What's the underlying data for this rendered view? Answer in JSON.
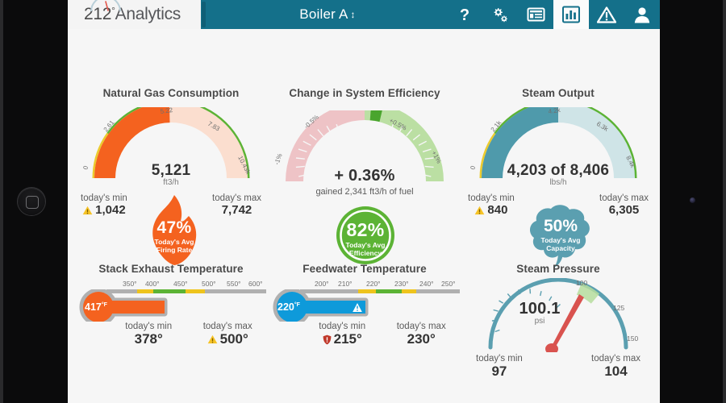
{
  "header": {
    "logo_text": "212",
    "logo_degree": "°",
    "logo_name": "Analytics",
    "title": "Boiler A",
    "title_caret": "↕",
    "icons": [
      {
        "name": "help-icon",
        "label": "?"
      },
      {
        "name": "settings-gears-icon",
        "label": "Settings"
      },
      {
        "name": "reports-list-icon",
        "label": "Reports"
      },
      {
        "name": "dashboard-chart-icon",
        "label": "Dashboard",
        "active": true
      },
      {
        "name": "alerts-warning-icon",
        "label": "Alerts"
      },
      {
        "name": "user-account-icon",
        "label": "Account"
      }
    ]
  },
  "colors": {
    "header_teal": "#14708a",
    "orange": "#f4621f",
    "green": "#5cb335",
    "teal": "#4f9aab",
    "blue": "#0e9ada",
    "yellow": "#f2c014",
    "red": "#d94b4b"
  },
  "panels": {
    "natural_gas": {
      "title": "Natural Gas Consumption",
      "value": "5,121",
      "unit": "ft3/h",
      "ticks": [
        "0",
        "2.61",
        "5.22",
        "7.83",
        "10.43k"
      ],
      "min_label": "today's min",
      "min_value": "1,042",
      "min_warn": true,
      "max_label": "today's max",
      "max_value": "7,742",
      "max_warn": false,
      "badge_pct": "47%",
      "badge_line1": "Today's Avg",
      "badge_line2": "Firing Rate"
    },
    "system_efficiency": {
      "title": "Change in System Efficiency",
      "value": "+ 0.36%",
      "subnote": "gained 2,341 ft3/h of fuel",
      "ticks": [
        "-1%",
        "-0.5%",
        "+0.5%",
        "+1%"
      ],
      "badge_pct": "82%",
      "badge_line1": "Today's Avg",
      "badge_line2": "Efficiency"
    },
    "steam_output": {
      "title": "Steam Output",
      "value": "4,203 of 8,406",
      "unit": "lbs/h",
      "ticks": [
        "0",
        "2.1k",
        "4.2k",
        "6.3k",
        "8.4k"
      ],
      "min_label": "today's min",
      "min_value": "840",
      "min_warn": true,
      "max_label": "today's max",
      "max_value": "6,305",
      "max_warn": false,
      "badge_pct": "50%",
      "badge_line1": "Today's Avg",
      "badge_line2": "Capacity"
    },
    "stack_exhaust": {
      "title": "Stack Exhaust Temperature",
      "value": "417",
      "value_deg": "°F",
      "ticks": [
        "350°",
        "400°",
        "450°",
        "500°",
        "550°",
        "600°"
      ],
      "min_label": "today's min",
      "min_value": "378°",
      "min_warn": false,
      "max_label": "today's max",
      "max_value": "500°",
      "max_warn": true
    },
    "feedwater": {
      "title": "Feedwater Temperature",
      "value": "220",
      "value_deg": "°F",
      "ticks": [
        "200°",
        "210°",
        "220°",
        "230°",
        "240°",
        "250°"
      ],
      "min_label": "today's min",
      "min_value": "215°",
      "min_shield": true,
      "max_label": "today's max",
      "max_value": "230°"
    },
    "steam_pressure": {
      "title": "Steam Pressure",
      "value": "100.1",
      "unit": "psi",
      "ticks": [
        "100",
        "125",
        "150"
      ],
      "min_label": "today's min",
      "min_value": "97",
      "max_label": "today's max",
      "max_value": "104"
    }
  },
  "chart_data": [
    {
      "type": "gauge",
      "title": "Natural Gas Consumption",
      "value": 5121,
      "unit": "ft3/h",
      "range": [
        0,
        10430
      ],
      "tick_values": [
        0,
        2610,
        5220,
        7830,
        10430
      ],
      "tick_labels": [
        "0",
        "2.61",
        "5.22",
        "7.83",
        "10.43k"
      ],
      "today_min": 1042,
      "today_max": 7742,
      "avg_firing_rate_pct": 47
    },
    {
      "type": "gauge",
      "title": "Change in System Efficiency",
      "value": 0.36,
      "unit": "%",
      "range": [
        -1,
        1
      ],
      "tick_values": [
        -1,
        -0.5,
        0.5,
        1
      ],
      "tick_labels": [
        "-1%",
        "-0.5%",
        "+0.5%",
        "+1%"
      ],
      "annotation": "gained 2,341 ft3/h of fuel",
      "avg_efficiency_pct": 82
    },
    {
      "type": "gauge",
      "title": "Steam Output",
      "value": 4203,
      "max_capacity": 8406,
      "unit": "lbs/h",
      "range": [
        0,
        8400
      ],
      "tick_values": [
        0,
        2100,
        4200,
        6300,
        8400
      ],
      "tick_labels": [
        "0",
        "2.1k",
        "4.2k",
        "6.3k",
        "8.4k"
      ],
      "today_min": 840,
      "today_max": 6305,
      "avg_capacity_pct": 50
    },
    {
      "type": "bar",
      "title": "Stack Exhaust Temperature",
      "value": 417,
      "unit": "°F",
      "range": [
        330,
        620
      ],
      "tick_values": [
        350,
        400,
        450,
        500,
        550,
        600
      ],
      "tick_labels": [
        "350°",
        "400°",
        "450°",
        "500°",
        "550°",
        "600°"
      ],
      "today_min": 378,
      "today_max": 500
    },
    {
      "type": "bar",
      "title": "Feedwater Temperature",
      "value": 220,
      "unit": "°F",
      "range": [
        196,
        254
      ],
      "tick_values": [
        200,
        210,
        220,
        230,
        240,
        250
      ],
      "tick_labels": [
        "200°",
        "210°",
        "220°",
        "230°",
        "240°",
        "250°"
      ],
      "today_min": 215,
      "today_max": 230
    },
    {
      "type": "gauge",
      "title": "Steam Pressure",
      "value": 100.1,
      "unit": "psi",
      "range": [
        0,
        150
      ],
      "tick_values": [
        100,
        125,
        150
      ],
      "tick_labels": [
        "100",
        "125",
        "150"
      ],
      "today_min": 97,
      "today_max": 104
    }
  ]
}
